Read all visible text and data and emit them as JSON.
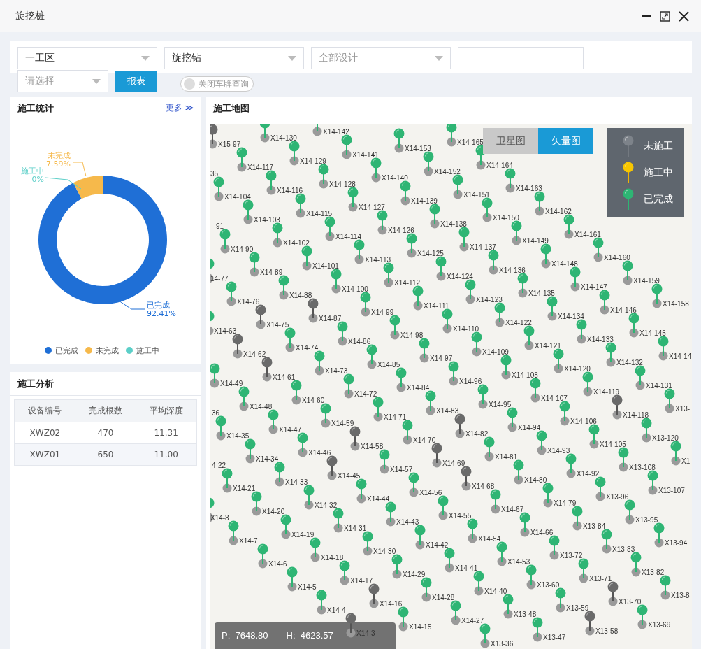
{
  "window": {
    "title": "旋挖桩"
  },
  "filters": {
    "area": {
      "value": "一工区"
    },
    "machine": {
      "value": "旋挖钻"
    },
    "design": {
      "placeholder": "全部设计"
    },
    "choose": {
      "placeholder": "请选择"
    },
    "report_button": "报表",
    "plate_toggle": {
      "label": "关闭车牌查询",
      "on": false
    }
  },
  "stats": {
    "title": "施工统计",
    "more": "更多",
    "more_icon": "≫",
    "chart_data": {
      "type": "donut",
      "categories": [
        "已完成",
        "未完成",
        "施工中"
      ],
      "values": [
        92.41,
        7.59,
        0
      ],
      "value_labels": [
        "92.41%",
        "7.59%",
        "0%"
      ]
    },
    "legend": [
      {
        "label": "已完成",
        "color": "#1f6fd6"
      },
      {
        "label": "未完成",
        "color": "#f6b94b"
      },
      {
        "label": "施工中",
        "color": "#5ccfc8"
      }
    ]
  },
  "analysis": {
    "title": "施工分析",
    "columns": [
      "设备编号",
      "完成根数",
      "平均深度"
    ],
    "rows": [
      [
        "XWZ02",
        "470",
        "11.31"
      ],
      [
        "XWZ01",
        "650",
        "11.00"
      ]
    ]
  },
  "map": {
    "title": "施工地图",
    "views": [
      {
        "label": "卫星图",
        "selected": false
      },
      {
        "label": "矢量图",
        "selected": true
      }
    ],
    "legend": [
      {
        "label": "未施工",
        "kind": "idle"
      },
      {
        "label": "施工中",
        "kind": "active"
      },
      {
        "label": "已完成",
        "kind": "done"
      }
    ],
    "diagonals": [
      [
        {
          "label": "X14-165",
          "kind": "done"
        },
        {
          "label": "X14-164",
          "kind": "done"
        },
        {
          "label": "X14-163",
          "kind": "done"
        },
        {
          "label": "X14-162",
          "kind": "done"
        },
        {
          "label": "X14-161",
          "kind": "done"
        },
        {
          "label": "X14-160",
          "kind": "done"
        },
        {
          "label": "X14-159",
          "kind": "done"
        },
        {
          "label": "X14-158",
          "kind": "done"
        }
      ],
      [
        {
          "label": "X14-153",
          "kind": "done"
        },
        {
          "label": "X14-152",
          "kind": "done"
        },
        {
          "label": "X14-151",
          "kind": "done"
        },
        {
          "label": "X14-150",
          "kind": "done"
        },
        {
          "label": "X14-149",
          "kind": "done"
        },
        {
          "label": "X14-148",
          "kind": "done"
        },
        {
          "label": "X14-147",
          "kind": "done"
        },
        {
          "label": "X14-146",
          "kind": "done"
        },
        {
          "label": "X14-145",
          "kind": "done"
        },
        {
          "label": "X14-14",
          "kind": "done"
        }
      ],
      [
        {
          "label": "X14-142",
          "kind": "done"
        },
        {
          "label": "X14-141",
          "kind": "done"
        },
        {
          "label": "X14-140",
          "kind": "done"
        },
        {
          "label": "X14-139",
          "kind": "done"
        },
        {
          "label": "X14-138",
          "kind": "done"
        },
        {
          "label": "X14-137",
          "kind": "done"
        },
        {
          "label": "X14-136",
          "kind": "done"
        },
        {
          "label": "X14-135",
          "kind": "done"
        },
        {
          "label": "X14-134",
          "kind": "done"
        },
        {
          "label": "X14-133",
          "kind": "done"
        },
        {
          "label": "X14-132",
          "kind": "done"
        },
        {
          "label": "X14-131",
          "kind": "done"
        },
        {
          "label": "X13-",
          "kind": "done"
        }
      ],
      [
        {
          "label": "X14-130",
          "kind": "done"
        },
        {
          "label": "X14-129",
          "kind": "done"
        },
        {
          "label": "X14-128",
          "kind": "done"
        },
        {
          "label": "X14-127",
          "kind": "done"
        },
        {
          "label": "X14-126",
          "kind": "done"
        },
        {
          "label": "X14-125",
          "kind": "done"
        },
        {
          "label": "X14-124",
          "kind": "done"
        },
        {
          "label": "X14-123",
          "kind": "done"
        },
        {
          "label": "X14-122",
          "kind": "done"
        },
        {
          "label": "X14-121",
          "kind": "done"
        },
        {
          "label": "X14-120",
          "kind": "done"
        },
        {
          "label": "X14-119",
          "kind": "done"
        },
        {
          "label": "X14-118",
          "kind": "idle"
        },
        {
          "label": "X13-120",
          "kind": "done"
        },
        {
          "label": "X1",
          "kind": "done"
        }
      ],
      [
        {
          "label": "X15-97",
          "kind": "idle"
        },
        {
          "label": "X14-117",
          "kind": "done"
        },
        {
          "label": "X14-116",
          "kind": "done"
        },
        {
          "label": "X14-115",
          "kind": "done"
        },
        {
          "label": "X14-114",
          "kind": "done"
        },
        {
          "label": "X14-113",
          "kind": "done"
        },
        {
          "label": "X14-112",
          "kind": "done"
        },
        {
          "label": "X14-111",
          "kind": "done"
        },
        {
          "label": "X14-110",
          "kind": "done"
        },
        {
          "label": "X14-109",
          "kind": "done"
        },
        {
          "label": "X14-108",
          "kind": "done"
        },
        {
          "label": "X14-107",
          "kind": "done"
        },
        {
          "label": "X14-106",
          "kind": "done"
        },
        {
          "label": "X14-105",
          "kind": "done"
        },
        {
          "label": "X13-108",
          "kind": "done"
        },
        {
          "label": "X13-107",
          "kind": "done"
        }
      ],
      [
        {
          "label": "35"
        },
        {
          "label": "X14-104",
          "kind": "done"
        },
        {
          "label": "X14-103",
          "kind": "done"
        },
        {
          "label": "X14-102",
          "kind": "done"
        },
        {
          "label": "X14-101",
          "kind": "done"
        },
        {
          "label": "X14-100",
          "kind": "done"
        },
        {
          "label": "X14-99",
          "kind": "done"
        },
        {
          "label": "X14-98",
          "kind": "done"
        },
        {
          "label": "X14-97",
          "kind": "done"
        },
        {
          "label": "X14-96",
          "kind": "done"
        },
        {
          "label": "X14-95",
          "kind": "done"
        },
        {
          "label": "X14-94",
          "kind": "done"
        },
        {
          "label": "X14-93",
          "kind": "done"
        },
        {
          "label": "X14-92",
          "kind": "done"
        },
        {
          "label": "X13-96",
          "kind": "done"
        },
        {
          "label": "X13-95",
          "kind": "done"
        },
        {
          "label": "X13-94",
          "kind": "done"
        }
      ],
      [
        {
          "label": "-91"
        },
        {
          "label": "X14-90",
          "kind": "done"
        },
        {
          "label": "X14-89",
          "kind": "done"
        },
        {
          "label": "X14-88",
          "kind": "done"
        },
        {
          "label": "X14-87",
          "kind": "idle"
        },
        {
          "label": "X14-86",
          "kind": "done"
        },
        {
          "label": "X14-85",
          "kind": "done"
        },
        {
          "label": "X14-84",
          "kind": "done"
        },
        {
          "label": "X14-83",
          "kind": "done"
        },
        {
          "label": "X14-82",
          "kind": "idle"
        },
        {
          "label": "X14-81",
          "kind": "done"
        },
        {
          "label": "X14-80",
          "kind": "done"
        },
        {
          "label": "X14-79",
          "kind": "done"
        },
        {
          "label": "X13-84",
          "kind": "done"
        },
        {
          "label": "X13-83",
          "kind": "done"
        },
        {
          "label": "X13-82",
          "kind": "done"
        },
        {
          "label": "X13-8",
          "kind": "done"
        }
      ],
      [
        {
          "label": "14-77",
          "kind": "done"
        },
        {
          "label": "X14-76",
          "kind": "done"
        },
        {
          "label": "X14-75",
          "kind": "idle"
        },
        {
          "label": "X14-74",
          "kind": "done"
        },
        {
          "label": "X14-73",
          "kind": "done"
        },
        {
          "label": "X14-72",
          "kind": "done"
        },
        {
          "label": "X14-71",
          "kind": "done"
        },
        {
          "label": "X14-70",
          "kind": "done"
        },
        {
          "label": "X14-69",
          "kind": "idle"
        },
        {
          "label": "X14-68",
          "kind": "idle"
        },
        {
          "label": "X14-67",
          "kind": "done"
        },
        {
          "label": "X14-66",
          "kind": "done"
        },
        {
          "label": "X13-72",
          "kind": "done"
        },
        {
          "label": "X13-71",
          "kind": "done"
        },
        {
          "label": "X13-70",
          "kind": "idle"
        },
        {
          "label": "X13-69",
          "kind": "done"
        }
      ],
      [
        {
          "label": "X14-63",
          "kind": "done"
        },
        {
          "label": "X14-62",
          "kind": "idle"
        },
        {
          "label": "X14-61",
          "kind": "idle"
        },
        {
          "label": "X14-60",
          "kind": "done"
        },
        {
          "label": "X14-59",
          "kind": "done"
        },
        {
          "label": "X14-58",
          "kind": "idle"
        },
        {
          "label": "X14-57",
          "kind": "done"
        },
        {
          "label": "X14-56",
          "kind": "done"
        },
        {
          "label": "X14-55",
          "kind": "done"
        },
        {
          "label": "X14-54",
          "kind": "done"
        },
        {
          "label": "X14-53",
          "kind": "done"
        },
        {
          "label": "X13-60",
          "kind": "done"
        },
        {
          "label": "X13-59",
          "kind": "done"
        },
        {
          "label": "X13-58",
          "kind": "idle"
        }
      ],
      [
        {
          "label": "X14-49",
          "kind": "done"
        },
        {
          "label": "X14-48",
          "kind": "done"
        },
        {
          "label": "X14-47",
          "kind": "done"
        },
        {
          "label": "X14-46",
          "kind": "done"
        },
        {
          "label": "X14-45",
          "kind": "idle"
        },
        {
          "label": "X14-44",
          "kind": "done"
        },
        {
          "label": "X14-43",
          "kind": "done"
        },
        {
          "label": "X14-42",
          "kind": "done"
        },
        {
          "label": "X14-41",
          "kind": "done"
        },
        {
          "label": "X14-40",
          "kind": "done"
        },
        {
          "label": "X13-48",
          "kind": "done"
        },
        {
          "label": "X13-47",
          "kind": "done"
        }
      ],
      [
        {
          "label": "36"
        },
        {
          "label": "X14-35",
          "kind": "done"
        },
        {
          "label": "X14-34",
          "kind": "done"
        },
        {
          "label": "X14-33",
          "kind": "done"
        },
        {
          "label": "X14-32",
          "kind": "done"
        },
        {
          "label": "X14-31",
          "kind": "done"
        },
        {
          "label": "X14-30",
          "kind": "done"
        },
        {
          "label": "X14-29",
          "kind": "done"
        },
        {
          "label": "X14-28",
          "kind": "done"
        },
        {
          "label": "X14-27",
          "kind": "done"
        },
        {
          "label": "X13-36",
          "kind": "done"
        }
      ],
      [
        {
          "label": "4-22"
        },
        {
          "label": "X14-21",
          "kind": "done"
        },
        {
          "label": "X14-20",
          "kind": "done"
        },
        {
          "label": "X14-19",
          "kind": "done"
        },
        {
          "label": "X14-18",
          "kind": "done"
        },
        {
          "label": "X14-17",
          "kind": "done"
        },
        {
          "label": "X14-16",
          "kind": "idle"
        },
        {
          "label": "X14-15",
          "kind": "done"
        }
      ],
      [
        {
          "label": "X14-8",
          "kind": "done"
        },
        {
          "label": "X14-7",
          "kind": "done"
        },
        {
          "label": "X14-6",
          "kind": "done"
        },
        {
          "label": "X14-5",
          "kind": "done"
        },
        {
          "label": "X14-4",
          "kind": "done"
        },
        {
          "label": "X14-3",
          "kind": "idle"
        }
      ]
    ],
    "coords": [
      "P:  7648.80",
      "H:  4623.57"
    ]
  }
}
